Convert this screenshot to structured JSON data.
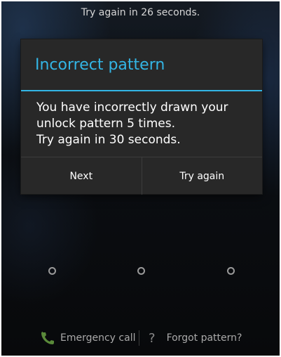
{
  "status": {
    "lockout_text": "Try again in 26 seconds."
  },
  "dialog": {
    "title": "Incorrect pattern",
    "message_lines": [
      "You have incorrectly drawn your",
      "unlock pattern 5 times.",
      "Try again in 30 seconds."
    ],
    "buttons": {
      "next": "Next",
      "try_again": "Try again"
    },
    "accent_color": "#33b5e5"
  },
  "footer": {
    "emergency_call": "Emergency call",
    "forgot_pattern": "Forgot pattern?",
    "phone_icon": "phone-icon",
    "help_icon": "question-mark-icon",
    "phone_icon_color": "#5a8a3a"
  }
}
